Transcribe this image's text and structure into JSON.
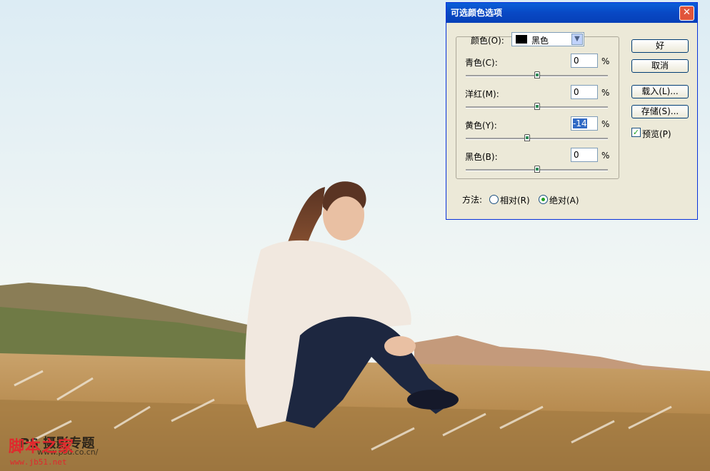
{
  "dialog": {
    "title": "可选颜色选项",
    "close_glyph": "✕",
    "colors_label": "颜色(O):",
    "colors_value": "黑色",
    "sliders": [
      {
        "label": "青色(C):",
        "value": "0",
        "level": 0.5
      },
      {
        "label": "洋红(M):",
        "value": "0",
        "level": 0.5
      },
      {
        "label": "黄色(Y):",
        "value": "-14",
        "level": 0.43
      },
      {
        "label": "黑色(B):",
        "value": "0",
        "level": 0.5
      }
    ],
    "percent": "%",
    "buttons": {
      "ok": "好",
      "cancel": "取消",
      "load": "载入(L)...",
      "save": "存储(S)..."
    },
    "preview_label": "预览(P)",
    "preview_checked": true,
    "method_label": "方法:",
    "method_relative": "相对(R)",
    "method_absolute": "绝对(A)",
    "method_selected": "absolute"
  },
  "watermark": {
    "brand": "脚本之家",
    "url": "www.jb51.net",
    "psd_text": "PS 摄影专题",
    "psd_url": "www.psd.co.cn/"
  }
}
